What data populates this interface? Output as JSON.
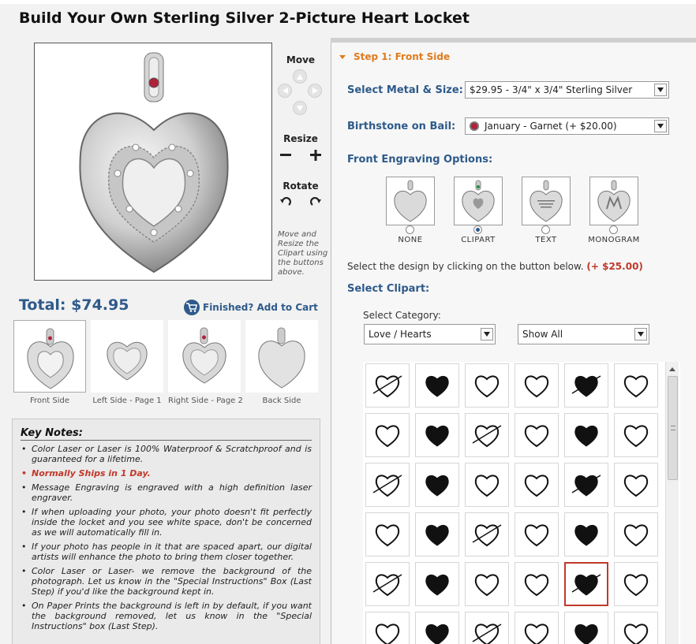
{
  "title": "Build Your Own Sterling Silver 2-Picture Heart Locket",
  "controls": {
    "move_label": "Move",
    "resize_label": "Resize",
    "rotate_label": "Rotate",
    "hint": "Move and Resize the Clipart using the buttons above."
  },
  "total": {
    "label": "Total:",
    "value": "$74.95"
  },
  "cart_label": "Finished? Add to Cart",
  "views": [
    {
      "label": "Front Side",
      "icon": "locket-front-view",
      "selected": true
    },
    {
      "label": "Left Side - Page 1",
      "icon": "locket-left-page-view",
      "selected": false
    },
    {
      "label": "Right Side - Page 2",
      "icon": "locket-right-page-view",
      "selected": false
    },
    {
      "label": "Back Side",
      "icon": "locket-back-view",
      "selected": false
    }
  ],
  "notes": {
    "title": "Key Notes:",
    "items": [
      "Color Laser or Laser is 100% Waterproof & Scratchproof and is guaranteed for a lifetime.",
      "Normally Ships in 1 Day.",
      "Message Engraving is engraved with a high definition laser engraver.",
      "If when uploading your photo, your photo doesn't fit perfectly inside the locket and you see white space, don't be concerned as we will automatically fill in.",
      "If your photo has people in it that are spaced apart, our digital artists will enhance the photo to bring them closer together.",
      "Color Laser or Laser- we remove the background of the photograph. Let us know in the \"Special Instructions\" Box (Last Step) if you'd like the background kept in.",
      "On Paper Prints the background is left in by default, if you want the background removed, let us know in the \"Special Instructions\" box (Last Step)."
    ]
  },
  "step_title": "Step 1: Front Side",
  "metal": {
    "label": "Select Metal & Size:",
    "value": "$29.95 - 3/4\" x 3/4\" Sterling Silver"
  },
  "birthstone": {
    "label": "Birthstone on Bail:",
    "value": "January - Garnet (+ $20.00)",
    "gem_color": "#b0213a"
  },
  "engraving": {
    "label": "Front Engraving Options:",
    "options": [
      {
        "label": "NONE",
        "selected": false
      },
      {
        "label": "CLIPART",
        "selected": true
      },
      {
        "label": "TEXT",
        "selected": false
      },
      {
        "label": "MONOGRAM",
        "selected": false
      }
    ]
  },
  "design_text": "Select the design by clicking on the button below.",
  "design_price": "(+ $25.00)",
  "clipart": {
    "label": "Select Clipart:",
    "category_label": "Select Category:",
    "category_value": "Love / Hearts",
    "filter_value": "Show All",
    "items": [
      "winged-envelope",
      "cupid-silhouette",
      "kissing-kids",
      "cherub-arrow",
      "heart-outline",
      "heart-arrow",
      "two-hearts-arrow",
      "two-black-hearts",
      "love-pen",
      "cherubs-pair",
      "couple-heart",
      "roses-heart",
      "bold-heart-outline",
      "teddy-bear-heart",
      "floral-heart",
      "bunny-heart",
      "heart-arrow-sketch",
      "double-heart-outline",
      "lips",
      "cherub-heart",
      "teddy-bears",
      "i-love-you-text",
      "heart-ribbon",
      "scattered-hearts",
      "rose-heart",
      "flower-tree-heart",
      "lace-heart",
      "double-heart-line",
      "scalloped-heart",
      "cherubs-small",
      "heart-frame",
      "black-hearts-pair",
      "hearts-bouquet",
      "cupid-bow",
      "cherub-hearts",
      "flower-bouquet"
    ],
    "selected_index": 28
  },
  "colors": {
    "accent": "#2e5a8a",
    "step": "#e07b1c",
    "price": "#c0392b"
  }
}
